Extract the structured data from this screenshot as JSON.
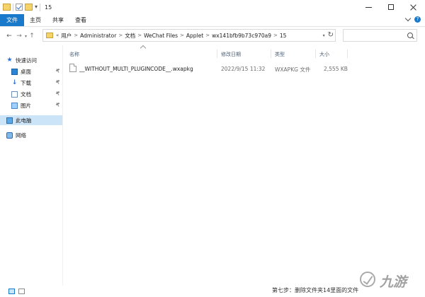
{
  "window": {
    "title": "15",
    "colors": {
      "accent": "#1979ca",
      "selected": "#cce4f7",
      "folder": "#f4d36b"
    }
  },
  "ribbon": {
    "tabs": [
      {
        "label": "文件",
        "active": true
      },
      {
        "label": "主页",
        "active": false
      },
      {
        "label": "共享",
        "active": false
      },
      {
        "label": "查看",
        "active": false
      }
    ],
    "help_label": "?"
  },
  "address": {
    "overflow_label": "«",
    "crumbs": [
      "用户",
      "Administrator",
      "文档",
      "WeChat Files",
      "Applet",
      "wx141bfb9b73c970a9",
      "15"
    ],
    "separator": ">"
  },
  "search": {
    "placeholder": ""
  },
  "nav": {
    "quick_access": "快速访问",
    "items": [
      {
        "label": "桌面",
        "icon": "desktop-icon",
        "pinned": true
      },
      {
        "label": "下载",
        "icon": "download-icon",
        "pinned": true
      },
      {
        "label": "文档",
        "icon": "documents-icon",
        "pinned": true
      },
      {
        "label": "图片",
        "icon": "pictures-icon",
        "pinned": true
      }
    ],
    "this_pc": "此电脑",
    "network": "网络"
  },
  "columns": {
    "name": "名称",
    "modified": "修改日期",
    "type": "类型",
    "size": "大小"
  },
  "files": [
    {
      "name": "__WITHOUT_MULTI_PLUGINCODE__.wxapkg",
      "modified": "2022/9/15 11:32",
      "type": "WXAPKG 文件",
      "size": "2,555 KB",
      "icon": "file-icon"
    }
  ],
  "caption": "第七步：删除文件夹14里面的文件",
  "watermark": {
    "text": "九游",
    "icon": "jiuyou-logo-icon"
  }
}
